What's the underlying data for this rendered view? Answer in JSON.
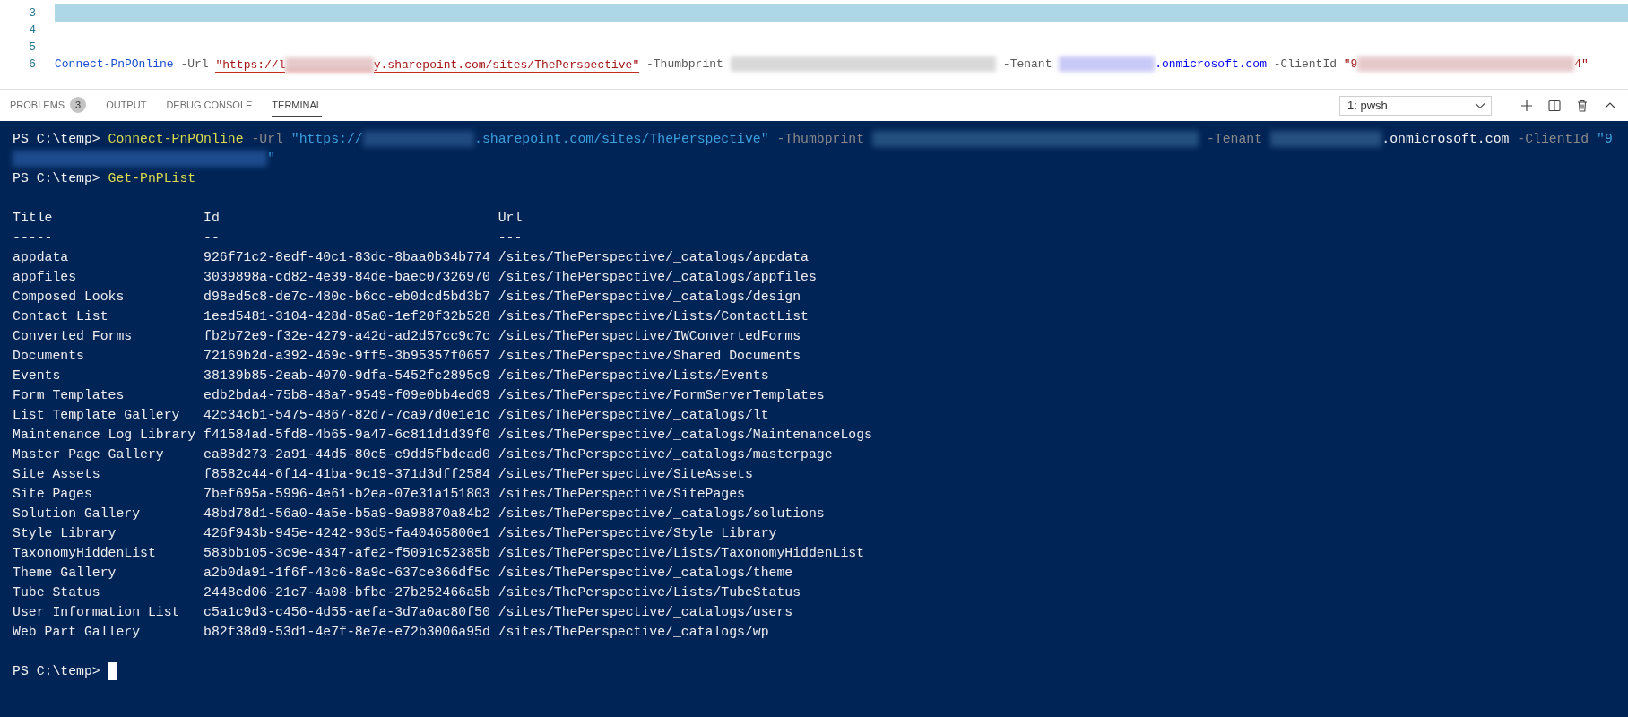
{
  "editor": {
    "lines": [
      {
        "number": "3",
        "highlighted": true
      },
      {
        "number": "4",
        "highlighted": false
      },
      {
        "number": "5",
        "highlighted": false
      },
      {
        "number": "6",
        "highlighted": false,
        "segments": [
          {
            "kind": "command",
            "text": "Connect-PnPOnline"
          },
          {
            "kind": "param",
            "text": " -Url "
          },
          {
            "kind": "string",
            "text": "\"https://l",
            "error": true
          },
          {
            "kind": "redacted",
            "error": true
          },
          {
            "kind": "string",
            "text": "y.sharepoint.com/sites/ThePerspective\"",
            "error": true
          },
          {
            "kind": "param",
            "text": " -Thumbprint "
          },
          {
            "kind": "redacted"
          },
          {
            "kind": "param",
            "text": " -Tenant "
          },
          {
            "kind": "redacted"
          },
          {
            "kind": "link",
            "text": ".onmicrosoft.com"
          },
          {
            "kind": "param",
            "text": " -ClientId "
          },
          {
            "kind": "string",
            "text": "\"9"
          },
          {
            "kind": "redacted"
          },
          {
            "kind": "string",
            "text": "4\""
          }
        ]
      }
    ]
  },
  "panel": {
    "tabs": [
      {
        "label": "PROBLEMS",
        "badge": "3",
        "selected": false
      },
      {
        "label": "OUTPUT",
        "selected": false
      },
      {
        "label": "DEBUG CONSOLE",
        "selected": false
      },
      {
        "label": "TERMINAL",
        "selected": true
      }
    ],
    "terminal_picker": "1: pwsh"
  },
  "terminal": {
    "lines_before": [
      {
        "segments": [
          {
            "kind": "prompt",
            "text": "PS C:\\temp> "
          },
          {
            "kind": "command",
            "text": "Connect-PnPOnline"
          },
          {
            "kind": "param",
            "text": " -Url "
          },
          {
            "kind": "string",
            "text": "\"https://"
          },
          {
            "kind": "redacted"
          },
          {
            "kind": "string",
            "text": ".sharepoint.com/sites/ThePerspective\""
          },
          {
            "kind": "param",
            "text": " -Thumbprint "
          },
          {
            "kind": "redacted"
          },
          {
            "kind": "param",
            "text": " -Tenant "
          },
          {
            "kind": "redacted"
          },
          {
            "kind": "text",
            "text": ".onmicrosoft.com"
          },
          {
            "kind": "param",
            "text": " -ClientId "
          },
          {
            "kind": "string",
            "text": "\"9"
          }
        ]
      },
      {
        "segments": [
          {
            "kind": "redacted"
          },
          {
            "kind": "string",
            "text": "\""
          }
        ]
      },
      {
        "segments": [
          {
            "kind": "prompt",
            "text": "PS C:\\temp> "
          },
          {
            "kind": "command",
            "text": "Get-PnPList"
          }
        ]
      }
    ],
    "table": {
      "columns": [
        "Title",
        "Id",
        "Url"
      ],
      "rules": [
        "-----",
        "--",
        "---"
      ],
      "rows": [
        {
          "title": "appdata",
          "id": "926f71c2-8edf-40c1-83dc-8baa0b34b774",
          "url": "/sites/ThePerspective/_catalogs/appdata"
        },
        {
          "title": "appfiles",
          "id": "3039898a-cd82-4e39-84de-baec07326970",
          "url": "/sites/ThePerspective/_catalogs/appfiles"
        },
        {
          "title": "Composed Looks",
          "id": "d98ed5c8-de7c-480c-b6cc-eb0dcd5bd3b7",
          "url": "/sites/ThePerspective/_catalogs/design"
        },
        {
          "title": "Contact List",
          "id": "1eed5481-3104-428d-85a0-1ef20f32b528",
          "url": "/sites/ThePerspective/Lists/ContactList"
        },
        {
          "title": "Converted Forms",
          "id": "fb2b72e9-f32e-4279-a42d-ad2d57cc9c7c",
          "url": "/sites/ThePerspective/IWConvertedForms"
        },
        {
          "title": "Documents",
          "id": "72169b2d-a392-469c-9ff5-3b95357f0657",
          "url": "/sites/ThePerspective/Shared Documents"
        },
        {
          "title": "Events",
          "id": "38139b85-2eab-4070-9dfa-5452fc2895c9",
          "url": "/sites/ThePerspective/Lists/Events"
        },
        {
          "title": "Form Templates",
          "id": "edb2bda4-75b8-48a7-9549-f09e0bb4ed09",
          "url": "/sites/ThePerspective/FormServerTemplates"
        },
        {
          "title": "List Template Gallery",
          "id": "42c34cb1-5475-4867-82d7-7ca97d0e1e1c",
          "url": "/sites/ThePerspective/_catalogs/lt"
        },
        {
          "title": "Maintenance Log Library",
          "id": "f41584ad-5fd8-4b65-9a47-6c811d1d39f0",
          "url": "/sites/ThePerspective/_catalogs/MaintenanceLogs"
        },
        {
          "title": "Master Page Gallery",
          "id": "ea88d273-2a91-44d5-80c5-c9dd5fbdead0",
          "url": "/sites/ThePerspective/_catalogs/masterpage"
        },
        {
          "title": "Site Assets",
          "id": "f8582c44-6f14-41ba-9c19-371d3dff2584",
          "url": "/sites/ThePerspective/SiteAssets"
        },
        {
          "title": "Site Pages",
          "id": "7bef695a-5996-4e61-b2ea-07e31a151803",
          "url": "/sites/ThePerspective/SitePages"
        },
        {
          "title": "Solution Gallery",
          "id": "48bd78d1-56a0-4a5e-b5a9-9a98870a84b2",
          "url": "/sites/ThePerspective/_catalogs/solutions"
        },
        {
          "title": "Style Library",
          "id": "426f943b-945e-4242-93d5-fa40465800e1",
          "url": "/sites/ThePerspective/Style Library"
        },
        {
          "title": "TaxonomyHiddenList",
          "id": "583bb105-3c9e-4347-afe2-f5091c52385b",
          "url": "/sites/ThePerspective/Lists/TaxonomyHiddenList"
        },
        {
          "title": "Theme Gallery",
          "id": "a2b0da91-1f6f-43c6-8a9c-637ce366df5c",
          "url": "/sites/ThePerspective/_catalogs/theme"
        },
        {
          "title": "Tube Status",
          "id": "2448ed06-21c7-4a08-bfbe-27b252466a5b",
          "url": "/sites/ThePerspective/Lists/TubeStatus"
        },
        {
          "title": "User Information List",
          "id": "c5a1c9d3-c456-4d55-aefa-3d7a0ac80f50",
          "url": "/sites/ThePerspective/_catalogs/users"
        },
        {
          "title": "Web Part Gallery",
          "id": "b82f38d9-53d1-4e7f-8e7e-e72b3006a95d",
          "url": "/sites/ThePerspective/_catalogs/wp"
        }
      ]
    },
    "lines_after": [
      {
        "segments": [
          {
            "kind": "prompt",
            "text": "PS C:\\temp> "
          },
          {
            "kind": "cursor"
          }
        ]
      }
    ]
  }
}
